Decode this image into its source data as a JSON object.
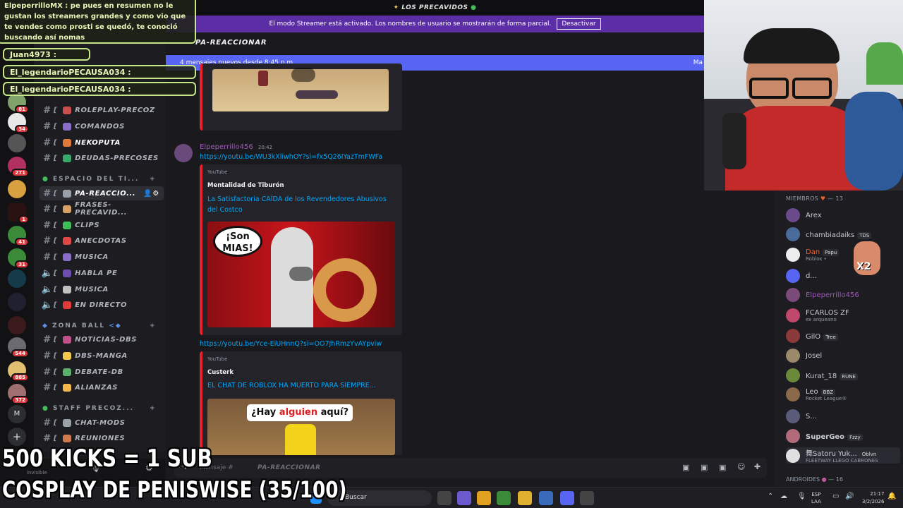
{
  "server": {
    "name": "LOS PRECAVIDOS"
  },
  "streamer_banner": {
    "text": "El modo Streamer está activado. Los nombres de usuario se mostrarán de forma parcial.",
    "button": "Desactivar"
  },
  "channel_header": {
    "name": "PA-REACCIONAR"
  },
  "new_messages": {
    "text": "4 mensajes nuevos desde 8:45 p.m.",
    "right": "Ma"
  },
  "rail_badges": [
    "81",
    "34",
    "271",
    "1",
    "41",
    "31",
    "544",
    "885",
    "372"
  ],
  "rail_labels": {
    "m": "M"
  },
  "categories": {
    "espacio": "ESPACIO DEL TI...",
    "zona": "ZONA BALL",
    "staff": "STAFF PRECOZ..."
  },
  "channels": [
    {
      "label": "ROLEPLAY-PRECOZ",
      "bracket": "[",
      "color": "#c94f4f"
    },
    {
      "label": "COMANDOS",
      "bracket": "[",
      "color": "#8a6ec5"
    },
    {
      "label": "NEKOPUTA",
      "bracket": "[",
      "color": "#e07a3a"
    },
    {
      "label": "DEUDAS-PRECOSES",
      "bracket": "[",
      "color": "#3aa86a"
    },
    {
      "label": "PA-REACCIO...",
      "bracket": "[",
      "color": "#9aa0a8"
    },
    {
      "label": "FRASES-PRECAVID...",
      "bracket": "[",
      "color": "#d9a066"
    },
    {
      "label": "CLIPS",
      "bracket": "[",
      "color": "#3ebd5a"
    },
    {
      "label": "ANECDOTAS",
      "bracket": "[",
      "color": "#e04848"
    },
    {
      "label": "MUSICA",
      "bracket": "[",
      "color": "#8a6ec5"
    },
    {
      "label": "HABLA PE",
      "bracket": "[",
      "color": "#6d4eb0"
    },
    {
      "label": "MUSICA",
      "bracket": "[",
      "color": "#c0c0c0"
    },
    {
      "label": "EN DIRECTO",
      "bracket": "[",
      "color": "#e03a3a"
    },
    {
      "label": "NOTICIAS-DBS",
      "bracket": "[",
      "color": "#c0508a"
    },
    {
      "label": "DBS-MANGA",
      "bracket": "[",
      "color": "#f2c94c"
    },
    {
      "label": "DEBATE-DB",
      "bracket": "[",
      "color": "#5ab06a"
    },
    {
      "label": "ALIANZAS",
      "bracket": "[",
      "color": "#f2b84c"
    },
    {
      "label": "CHAT-MODS",
      "bracket": "[",
      "color": "#9aa0a8"
    },
    {
      "label": "REUNIONES",
      "bracket": "[",
      "color": "#d07a50"
    }
  ],
  "message": {
    "author": "Elpeperrillo456",
    "time": "20:42",
    "link1": "https://youtu.be/WU3kXliwhOY?si=fx5Q26IYazTmFWFa",
    "embed1": {
      "provider": "YouTube",
      "channel": "Mentalidad de Tiburón",
      "title": "La Satisfactoria CAÍDA de los Revendedores Abusivos del Costco",
      "thumb_text": "¡Son MIAS!"
    },
    "link2": "https://youtu.be/Yce-EiUHnnQ?si=OO7JhRmzYvAYpviw",
    "embed2": {
      "provider": "YouTube",
      "channel": "Custerk",
      "title": "EL CHAT DE ROBLOX HA MUERTO PARA SIEMPRE...",
      "thumb_text_a": "¿Hay ",
      "thumb_text_b": "alguien",
      "thumb_text_c": " aquí?"
    }
  },
  "composer": {
    "placeholder": "Mensaje # ",
    "channel": "PA-REACCIONAR"
  },
  "members": {
    "header": "MIEMBROS",
    "count": "— 13",
    "list": [
      {
        "name": "Arex",
        "sub": "",
        "tag": ""
      },
      {
        "name": "chambiadaiks",
        "sub": "",
        "tag": "TDS"
      },
      {
        "name": "Dan",
        "sub": "Roblox •",
        "tag": "Papu"
      },
      {
        "name": "d...",
        "sub": "",
        "tag": ""
      },
      {
        "name": "Elpeperrillo456",
        "sub": "",
        "tag": ""
      },
      {
        "name": "FCARLOS ZF",
        "sub": "ex arqueano",
        "tag": ""
      },
      {
        "name": "GilO",
        "sub": "",
        "tag": "Tree"
      },
      {
        "name": "Josel",
        "sub": "",
        "tag": ""
      },
      {
        "name": "Kurat_18",
        "sub": "",
        "tag": "RUNE"
      },
      {
        "name": "Leo",
        "sub": "Rocket League®",
        "tag": "BBZ"
      },
      {
        "name": "S...",
        "sub": "",
        "tag": ""
      },
      {
        "name": "SuperGeo",
        "sub": "",
        "tag": "Fzzy"
      },
      {
        "name": "舞Satoru Yuk...",
        "sub": "FLEETWAY LLEGO CABRONES",
        "tag": "Oblvn"
      }
    ],
    "footer": "ANDROIDES",
    "footer_count": "— 16",
    "x2": "X2"
  },
  "user_panel": {
    "status": "invisible"
  },
  "chat_overlay": [
    {
      "text": "ElpeperrilloMX : pe pues en resumen no le gustan los streamers grandes y como vio que te vendes como prosti se quedó, te conoció buscando así nomas"
    },
    {
      "text": "Juan4973 :"
    },
    {
      "text": "El_legendarioPECAUSA034 :"
    },
    {
      "text": "El_legendarioPECAUSA034 :"
    }
  ],
  "overlay_text": {
    "line1": "500 KICKS = 1 SUB",
    "line2": "COSPLAY DE PENISWISE (35/100)"
  },
  "taskbar": {
    "search": "Buscar",
    "lang1": "ESP",
    "lang2": "LAA",
    "time": "21:17",
    "date": "3/2/2026"
  },
  "colors": {
    "accent": "#5865f2",
    "streamer": "#5b2ea6",
    "embed_border": "#e8222b",
    "overlay_border": "#c7e68b"
  }
}
